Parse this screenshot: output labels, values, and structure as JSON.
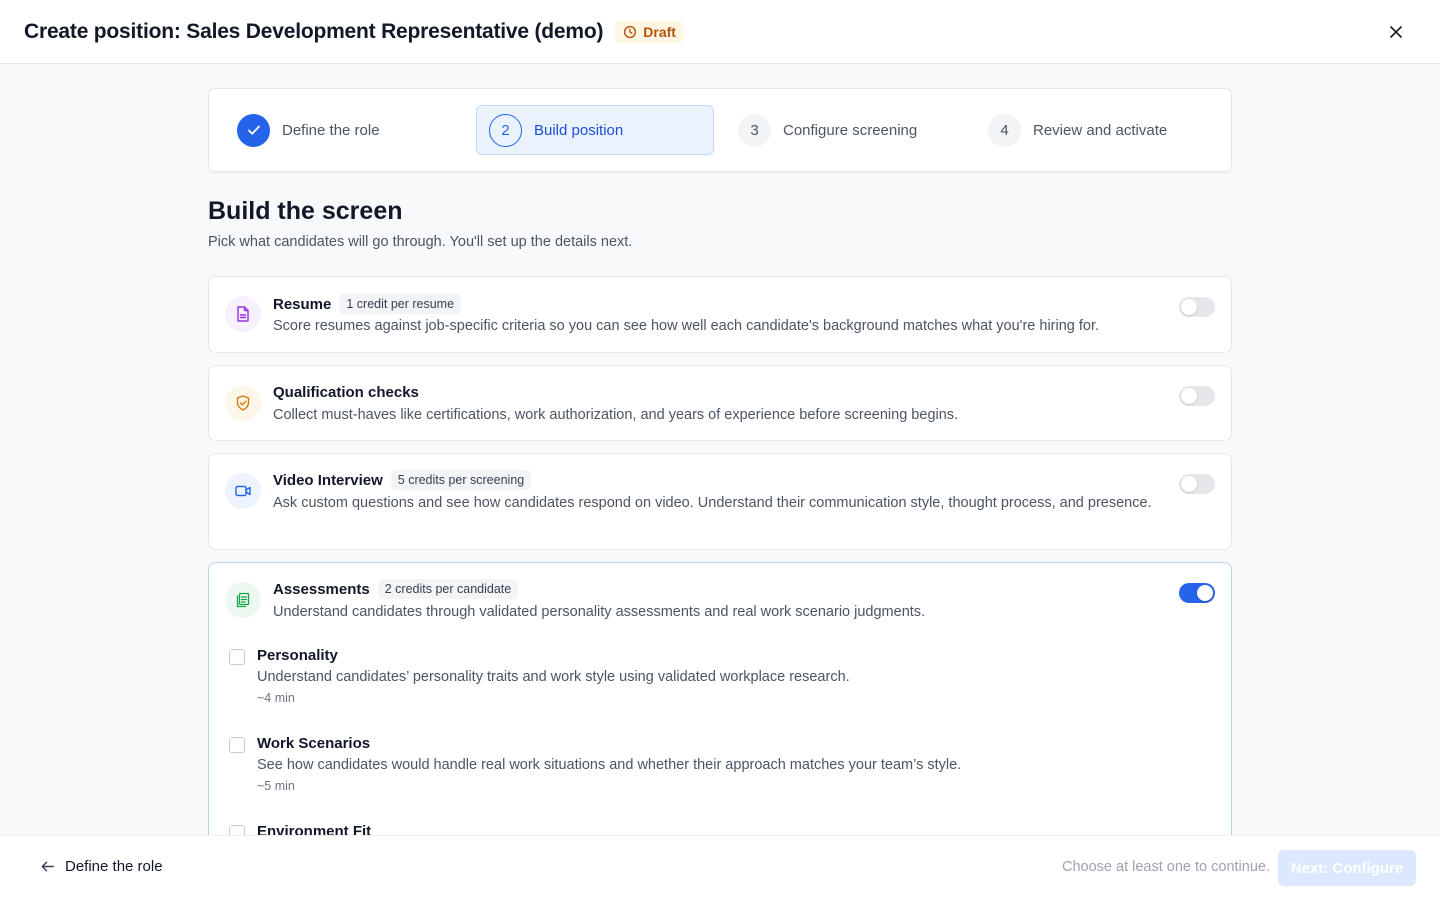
{
  "header": {
    "title": "Create position: Sales Development Representative (demo)",
    "status_badge": "Draft",
    "close_icon": "close-icon"
  },
  "stepper": {
    "steps": [
      {
        "number": "",
        "label": "Define the role",
        "state": "done"
      },
      {
        "number": "2",
        "label": "Build position",
        "state": "active"
      },
      {
        "number": "3",
        "label": "Configure screening",
        "state": "upcoming"
      },
      {
        "number": "4",
        "label": "Review and activate",
        "state": "upcoming"
      }
    ]
  },
  "main": {
    "title": "Build the screen",
    "subtitle": "Pick what candidates will go through. You'll set up the details next.",
    "cards": [
      {
        "title": "Resume",
        "badge": "1 credit per resume",
        "description": "Score resumes against job-specific criteria so you can see how well each candidate's background matches what you're hiring for.",
        "icon": "document-icon",
        "enabled": false
      },
      {
        "title": "Qualification checks",
        "badge": "",
        "description": "Collect must-haves like certifications, work authorization, and years of experience before screening begins.",
        "icon": "shield-check-icon",
        "enabled": false
      },
      {
        "title": "Video Interview",
        "badge": "5 credits per screening",
        "description": "Ask custom questions and see how candidates respond on video. Understand their communication style, thought process, and presence.",
        "icon": "video-camera-icon",
        "enabled": false
      },
      {
        "title": "Assessments",
        "badge": "2 credits per candidate",
        "description": "Understand candidates through validated personality assessments and real work scenario judgments.",
        "icon": "clipboard-icon",
        "enabled": true,
        "options": [
          {
            "title": "Personality",
            "description": "Understand candidates’ personality traits and work style using validated workplace research.",
            "time": "~4 min",
            "checked": false
          },
          {
            "title": "Work Scenarios",
            "description": "See how candidates would handle real work situations and whether their approach matches your team’s style.",
            "time": "~5 min",
            "checked": false
          },
          {
            "title": "Environment Fit",
            "description": "",
            "time": "",
            "checked": false
          }
        ]
      }
    ]
  },
  "footer": {
    "back_label": "Define the role",
    "hint": "Choose at least one to continue.",
    "next_label": "Next: Configure"
  },
  "colors": {
    "accent": "#2563eb",
    "draft": "#b45309",
    "resume_icon": "#9333ea",
    "qualification_icon": "#d97706",
    "video_icon": "#2563eb",
    "assessment_icon": "#16a34a"
  }
}
